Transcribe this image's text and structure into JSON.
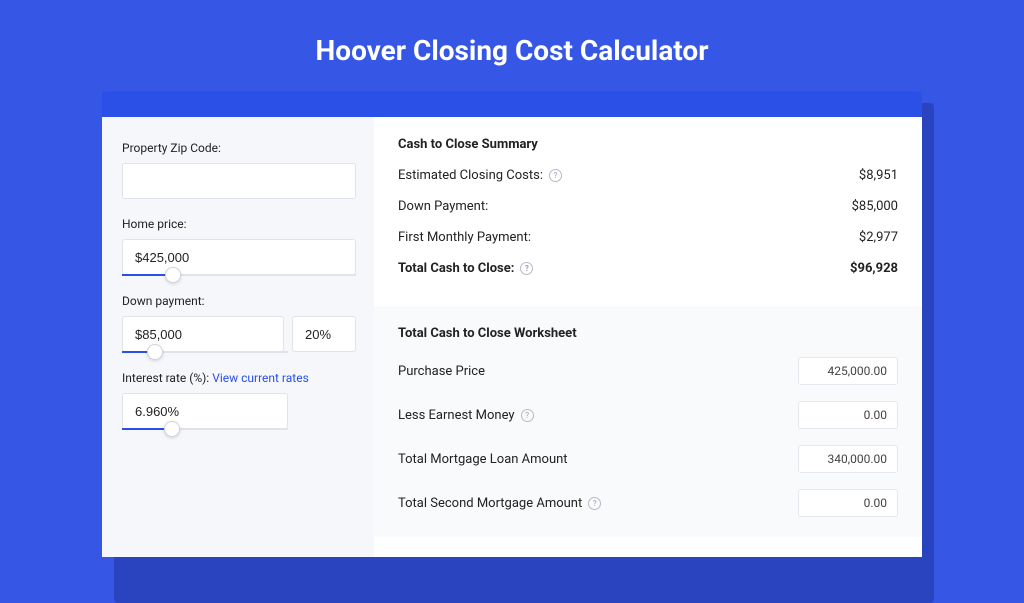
{
  "title": "Hoover Closing Cost Calculator",
  "form": {
    "zip": {
      "label": "Property Zip Code:",
      "value": ""
    },
    "home_price": {
      "label": "Home price:",
      "value": "$425,000",
      "slider_percent": 22
    },
    "down_payment": {
      "label": "Down payment:",
      "amount": "$85,000",
      "percent": "20%",
      "slider_percent": 20
    },
    "interest_rate": {
      "label": "Interest rate (%): ",
      "link_text": "View current rates",
      "value": "6.960%",
      "slider_percent": 30
    }
  },
  "summary": {
    "title": "Cash to Close Summary",
    "rows": [
      {
        "label": "Estimated Closing Costs:",
        "info": true,
        "value": "$8,951",
        "bold": false
      },
      {
        "label": "Down Payment:",
        "info": false,
        "value": "$85,000",
        "bold": false
      },
      {
        "label": "First Monthly Payment:",
        "info": false,
        "value": "$2,977",
        "bold": false
      },
      {
        "label": "Total Cash to Close:",
        "info": true,
        "value": "$96,928",
        "bold": true
      }
    ]
  },
  "worksheet": {
    "title": "Total Cash to Close Worksheet",
    "rows": [
      {
        "label": "Purchase Price",
        "info": false,
        "value": "425,000.00"
      },
      {
        "label": "Less Earnest Money",
        "info": true,
        "value": "0.00"
      },
      {
        "label": "Total Mortgage Loan Amount",
        "info": false,
        "value": "340,000.00"
      },
      {
        "label": "Total Second Mortgage Amount",
        "info": true,
        "value": "0.00"
      }
    ]
  }
}
